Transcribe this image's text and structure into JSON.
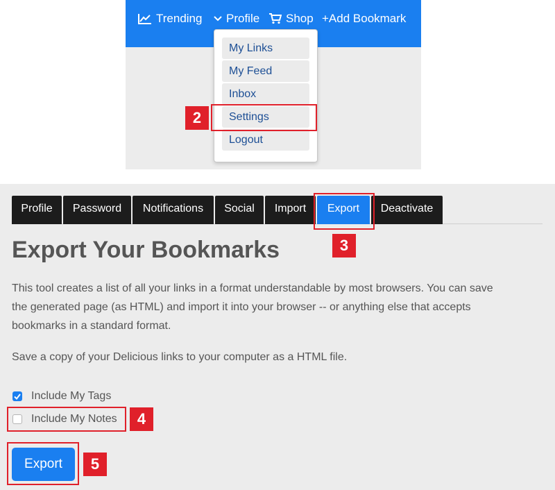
{
  "navbar": {
    "trending": "Trending",
    "profile": "Profile",
    "shop": "Shop",
    "add_bookmark": "+Add Bookmark"
  },
  "dropdown": {
    "items": [
      "My Links",
      "My Feed",
      "Inbox",
      "Settings",
      "Logout"
    ]
  },
  "steps": [
    "2",
    "3",
    "4",
    "5"
  ],
  "tabs": [
    "Profile",
    "Password",
    "Notifications",
    "Social",
    "Import",
    "Export",
    "Deactivate"
  ],
  "main": {
    "title": "Export Your Bookmarks",
    "description_lines": [
      "This tool creates a list of all your links in a format understandable by most browsers. You can save",
      "the generated page (as HTML) and import it into your browser -- or anything else that accepts",
      "bookmarks in a standard format."
    ],
    "save_text": "Save a copy of your Delicious links to your computer as a HTML file.",
    "options": [
      {
        "label": "Include My Tags",
        "checked": true
      },
      {
        "label": "Include My Notes",
        "checked": false
      }
    ],
    "export_button": "Export"
  },
  "colors": {
    "accent": "#1a7ff0",
    "highlight": "#e0202a",
    "tab_dark": "#1c1c1c"
  }
}
